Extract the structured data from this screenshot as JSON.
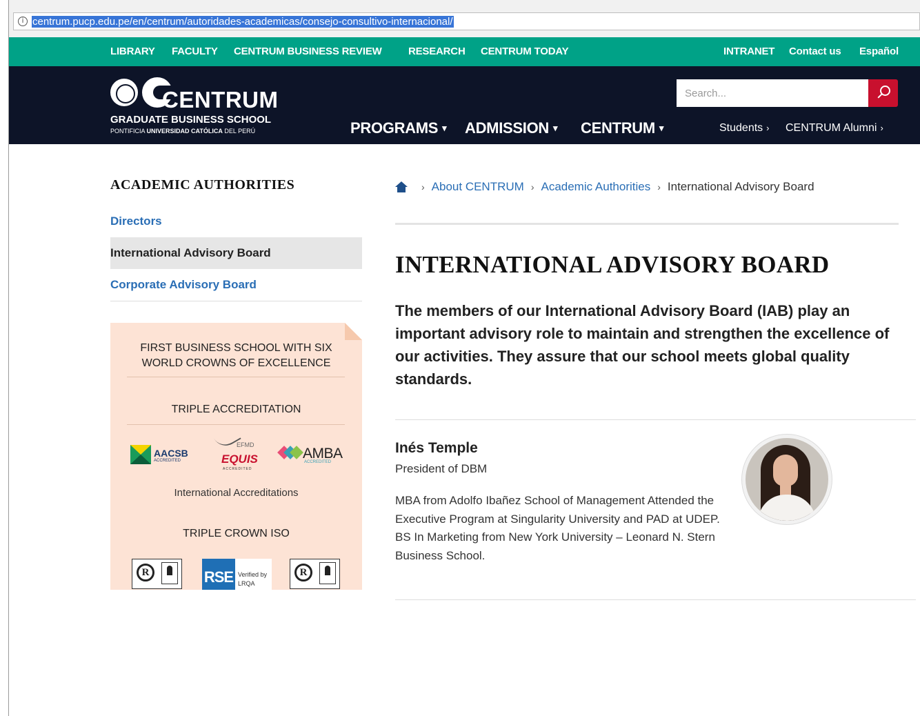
{
  "browser": {
    "url": "centrum.pucp.edu.pe/en/centrum/autoridades-academicas/consejo-consultivo-internacional/"
  },
  "topbar": {
    "left_links": [
      "LIBRARY",
      "FACULTY",
      "CENTRUM BUSINESS REVIEW",
      "RESEARCH",
      "CENTRUM TODAY"
    ],
    "right_links": [
      "INTRANET",
      "Contact us",
      "Español"
    ]
  },
  "header": {
    "logo_word": "CENTRUM",
    "logo_line1": "GRADUATE BUSINESS SCHOOL",
    "logo_line2_pre": "PONTIFICIA",
    "logo_line2_bold": "UNIVERSIDAD CATÓLICA",
    "logo_line2_post": "DEL PERÚ",
    "nav": [
      "PROGRAMS",
      "ADMISSION",
      "CENTRUM"
    ],
    "nav_caret": "▾",
    "search_placeholder": "Search...",
    "sublinks": [
      "Students",
      "CENTRUM Alumni"
    ],
    "sublink_chevron": "›"
  },
  "sidebar": {
    "title": "ACADEMIC AUTHORITIES",
    "items": [
      {
        "label": "Directors",
        "active": false
      },
      {
        "label": "International Advisory Board",
        "active": true
      },
      {
        "label": "Corporate Advisory Board",
        "active": false
      }
    ],
    "promo": {
      "headline_line1": "FIRST BUSINESS SCHOOL WITH SIX",
      "headline_line2": "WORLD CROWNS OF EXCELLENCE",
      "section1": "TRIPLE ACCREDITATION",
      "aacsb": "AACSB",
      "aacsb_sub": "ACCREDITED",
      "efmd": "EFMD",
      "equis": "EQUIS",
      "equis_sub": "ACCREDITED",
      "amba": "AMBA",
      "amba_sub": "ACCREDITED",
      "caption": "International Accreditations",
      "section2": "TRIPLE CROWN ISO",
      "iso_mark": "R",
      "rse": "RSE",
      "rse_verified1": "Verified by",
      "rse_verified2": "LRQA"
    }
  },
  "breadcrumb": {
    "separator": "›",
    "items": [
      "About CENTRUM",
      "Academic Authorities"
    ],
    "current": "International Advisory Board"
  },
  "main": {
    "title": "INTERNATIONAL ADVISORY BOARD",
    "lead": "The members of our International Advisory Board (IAB) play an important advisory role to maintain and strengthen the excellence of our activities. They assure that our school meets global quality standards.",
    "members": [
      {
        "name": "Inés Temple",
        "role": "President of DBM",
        "bio": "MBA from Adolfo Ibañez School of Management Attended the Executive Program at Singularity University and PAD at UDEP. BS In Marketing from New York University – Leonard N. Stern Business School."
      }
    ]
  },
  "colors": {
    "topbar": "#00a287",
    "header": "#0d1428",
    "search_button": "#c8102e",
    "link": "#2a6eb5",
    "promo_bg": "#fde3d5"
  }
}
